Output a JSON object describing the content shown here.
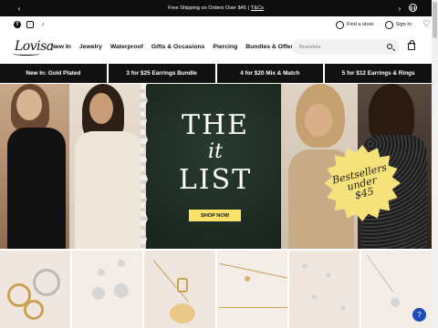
{
  "announcement": {
    "text": "Free Shipping on Orders Over $45 |",
    "link": "T&Cs",
    "prev_icon": "chevron-left-icon",
    "next_icon": "chevron-right-icon",
    "pause_icon": "pause-icon"
  },
  "utility": {
    "social": [
      "facebook-icon",
      "instagram-icon",
      "tiktok-icon"
    ],
    "find_store": "Find a store",
    "sign_in": "Sign In"
  },
  "nav": {
    "logo": "Lovisa",
    "items": [
      "New In",
      "Jewelry",
      "Waterproof",
      "Gifts & Occasions",
      "Piercing",
      "Bundles & Offers"
    ],
    "search_placeholder": "Bracelets"
  },
  "promo": [
    "New In: Gold Plated",
    "3 for $25 Earrings Bundle",
    "4 for $20 Mix & Match",
    "5 for $12 Earrings & Rings"
  ],
  "hero": {
    "title_line1": "THE",
    "title_line2": "it",
    "title_line3": "LIST",
    "cta": "SHOP NOW",
    "badge_line1": "Bestsellers",
    "badge_line2": "under",
    "badge_line3": "$45"
  },
  "colors": {
    "announce_bg": "#0d0d0d",
    "hero_bg": "#1b2a21",
    "cta_bg": "#fbe36a",
    "badge_bg": "#f6e27a",
    "chat_bg": "#1a4bb8"
  }
}
